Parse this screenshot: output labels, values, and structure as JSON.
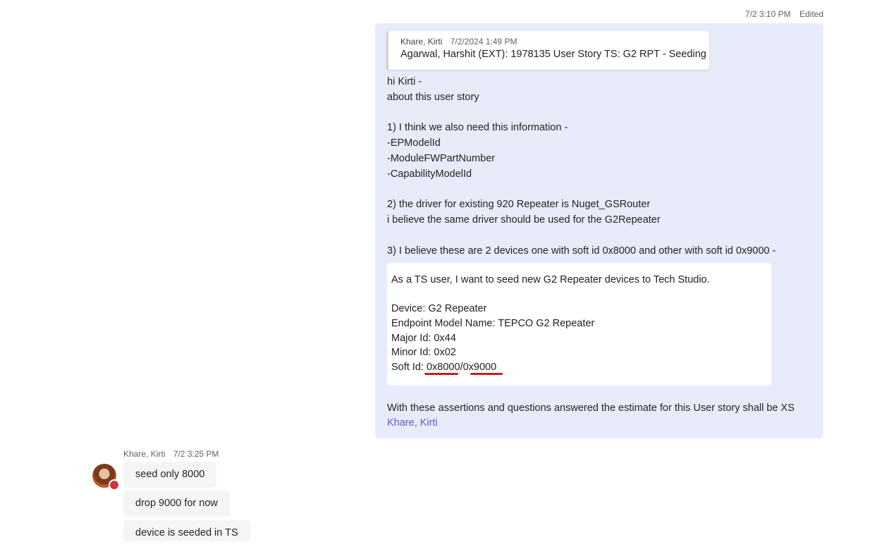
{
  "outgoing": {
    "timestamp": "7/2 3:10 PM",
    "edited_label": "Edited",
    "quote": {
      "author": "Khare, Kirti",
      "time": "7/2/2024 1:49 PM",
      "text": "Agarwal, Harshit (EXT): 1978135 User Story TS: G2 RPT - Seeding"
    },
    "lines": [
      "hi Kirti -",
      "about this user story",
      "",
      "1) I think we also need this information -",
      "-EPModelId",
      "-ModuleFWPartNumber",
      "-CapabilityModelId",
      "",
      "2) the driver for existing 920 Repeater  is Nuget_GSRouter",
      "i believe the same driver should be used for the G2Repeater",
      "",
      "3) I believe these are 2 devices one with soft id 0x8000 and other with soft id 0x9000 -"
    ],
    "embed": {
      "lines": [
        "As a TS user, I want to seed new G2 Repeater devices to Tech Studio.",
        "",
        "Device: G2 Repeater",
        "Endpoint Model Name: TEPCO G2 Repeater",
        "Major Id: 0x44",
        "Minor Id: 0x02"
      ],
      "soft_id_label": "Soft Id: ",
      "soft_id_a": "0x8000",
      "soft_id_sep": "/",
      "soft_id_b": "0x9000",
      "annotation_color": "#d11b1b"
    },
    "closing": "With these assertions and questions answered the estimate for this User story shall be XS",
    "mention": "Khare, Kirti"
  },
  "incoming": {
    "sender": "Khare, Kirti",
    "time": "7/2 3:25 PM",
    "presence_status_color": "#d13438",
    "messages": [
      "seed only 8000",
      "drop 9000 for now",
      "device is seeded in TS"
    ]
  },
  "colors": {
    "my_bubble": "#e8ebfa",
    "other_bubble": "#f5f5f5",
    "mention": "#5b5fc7"
  }
}
